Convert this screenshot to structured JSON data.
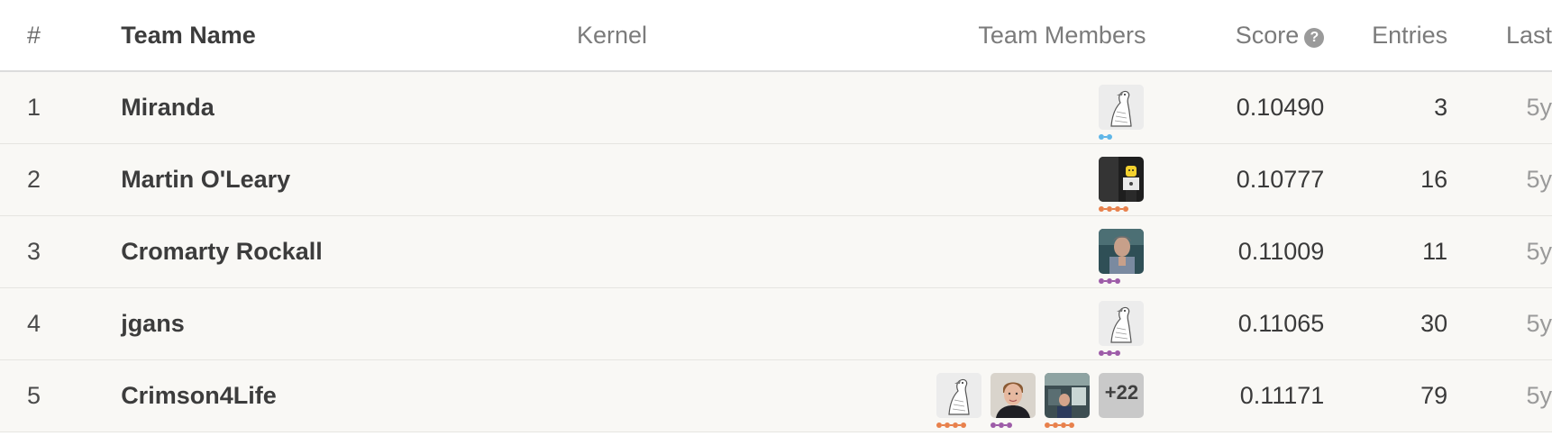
{
  "header": {
    "rank": "#",
    "team_name": "Team Name",
    "kernel": "Kernel",
    "team_members": "Team Members",
    "score": "Score",
    "score_help_icon": "question-circle-icon",
    "entries": "Entries",
    "last": "Last"
  },
  "tier_colors": {
    "novice": "#5fb6e8",
    "contributor": "#e8814c",
    "expert": "#9d5ca8"
  },
  "rows": [
    {
      "rank": "1",
      "team": "Miranda",
      "score": "0.10490",
      "entries": "3",
      "last": "5y",
      "members": [
        {
          "avatar": "goose-avatar",
          "tier": "novice"
        }
      ]
    },
    {
      "rank": "2",
      "team": "Martin O'Leary",
      "score": "0.10777",
      "entries": "16",
      "last": "5y",
      "members": [
        {
          "avatar": "lego-figure-avatar",
          "tier": "contributor"
        }
      ]
    },
    {
      "rank": "3",
      "team": "Cromarty Rockall",
      "score": "0.11009",
      "entries": "11",
      "last": "5y",
      "members": [
        {
          "avatar": "puppet-avatar",
          "tier": "expert"
        }
      ]
    },
    {
      "rank": "4",
      "team": "jgans",
      "score": "0.11065",
      "entries": "30",
      "last": "5y",
      "members": [
        {
          "avatar": "goose-avatar",
          "tier": "expert"
        }
      ]
    },
    {
      "rank": "5",
      "team": "Crimson4Life",
      "score": "0.11171",
      "entries": "79",
      "last": "5y",
      "members": [
        {
          "avatar": "goose-avatar",
          "tier": "contributor"
        },
        {
          "avatar": "photo-portrait-avatar",
          "tier": "expert"
        },
        {
          "avatar": "photo-office-avatar",
          "tier": "contributor"
        }
      ],
      "more_members": "+22"
    }
  ]
}
